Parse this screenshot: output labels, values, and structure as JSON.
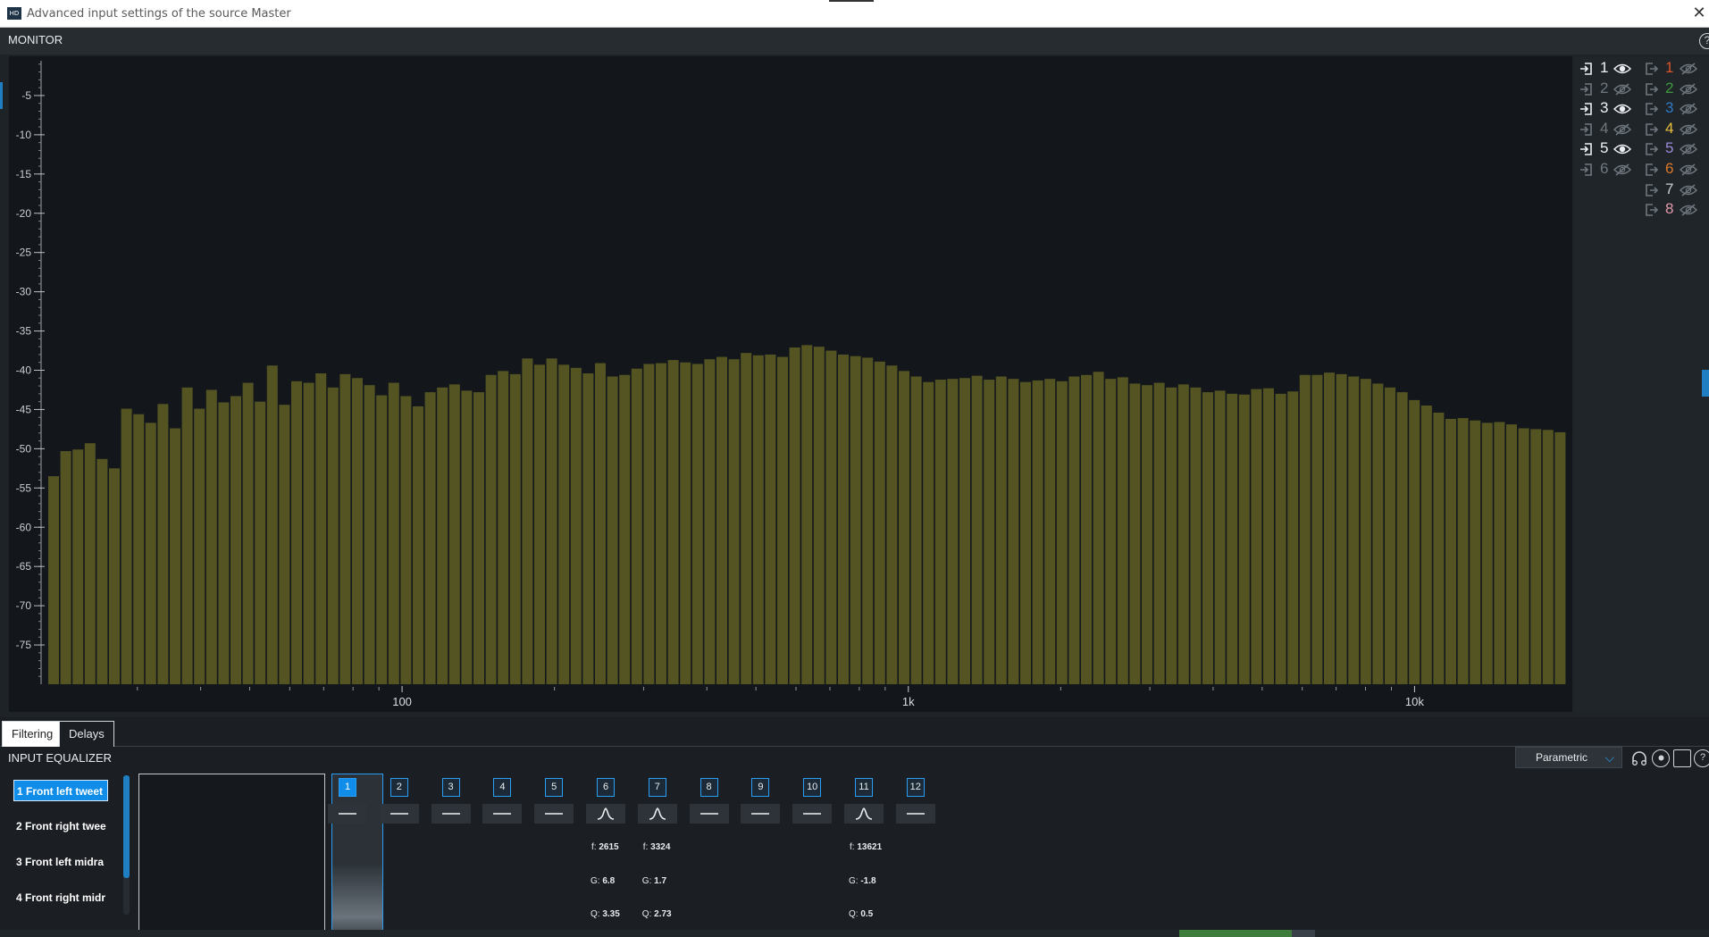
{
  "window": {
    "title": "Advanced input settings of the source Master",
    "app_icon_text": "HD",
    "close_glyph": "✕"
  },
  "monitor": {
    "title": "MONITOR",
    "help": "?"
  },
  "chart_data": {
    "type": "bar",
    "x_scale": "log",
    "y_ticks": [
      -5,
      -10,
      -15,
      -20,
      -25,
      -30,
      -35,
      -40,
      -45,
      -50,
      -55,
      -60,
      -65,
      -70,
      -75
    ],
    "ylim": [
      -80,
      0
    ],
    "x_tick_labels": [
      "100",
      "1k",
      "10k"
    ],
    "bar_color": "#545423",
    "series": [
      {
        "values": [
          -53.5,
          -50.3,
          -50.1,
          -49.3,
          -51.3,
          -52.5,
          -44.9,
          -45.6,
          -46.7,
          -44.3,
          -47.4,
          -42.2,
          -44.9,
          -42.5,
          -44.1,
          -43.3,
          -41.6,
          -44.0,
          -39.4,
          -44.4,
          -41.4,
          -41.6,
          -40.4,
          -42.2,
          -40.5,
          -41.0,
          -41.9,
          -43.2,
          -41.6,
          -43.3,
          -44.6,
          -42.8,
          -42.2,
          -41.8,
          -42.6,
          -42.8,
          -40.6,
          -40.1,
          -40.5,
          -38.5,
          -39.3,
          -38.5,
          -39.3,
          -39.7,
          -40.4,
          -39.1,
          -40.8,
          -40.6,
          -39.8,
          -39.2,
          -39.1,
          -38.7,
          -39.0,
          -39.2,
          -38.6,
          -38.3,
          -38.6,
          -37.8,
          -38.1,
          -38.0,
          -38.3,
          -37.1,
          -36.8,
          -37.0,
          -37.5,
          -38.0,
          -38.2,
          -38.4,
          -38.9,
          -39.4,
          -40.1,
          -40.8,
          -41.5,
          -41.2,
          -41.1,
          -41.0,
          -40.7,
          -41.2,
          -40.8,
          -41.1,
          -41.5,
          -41.3,
          -41.1,
          -41.4,
          -40.8,
          -40.6,
          -40.2,
          -41.1,
          -40.9,
          -41.7,
          -41.9,
          -41.6,
          -42.2,
          -41.8,
          -42.2,
          -42.8,
          -42.6,
          -43.0,
          -43.1,
          -42.4,
          -42.3,
          -43.0,
          -42.7,
          -40.6,
          -40.6,
          -40.3,
          -40.5,
          -40.8,
          -41.1,
          -41.7,
          -42.2,
          -42.8,
          -43.8,
          -44.5,
          -45.4,
          -46.2,
          -46.1,
          -46.4,
          -46.7,
          -46.6,
          -46.9,
          -47.4,
          -47.5,
          -47.6,
          -47.9
        ]
      }
    ]
  },
  "legend": {
    "inputs": [
      {
        "num": "1",
        "visible": true
      },
      {
        "num": "2",
        "visible": false
      },
      {
        "num": "3",
        "visible": true
      },
      {
        "num": "4",
        "visible": false
      },
      {
        "num": "5",
        "visible": true
      },
      {
        "num": "6",
        "visible": false
      }
    ],
    "outputs": [
      {
        "num": "1",
        "color": "#d9542b"
      },
      {
        "num": "2",
        "color": "#3f9a3f"
      },
      {
        "num": "3",
        "color": "#2f78c4"
      },
      {
        "num": "4",
        "color": "#e9c03a"
      },
      {
        "num": "5",
        "color": "#9b8ad8"
      },
      {
        "num": "6",
        "color": "#d8782a"
      },
      {
        "num": "7",
        "color": "#c9ced3"
      },
      {
        "num": "8",
        "color": "#e39aa8"
      }
    ]
  },
  "tabs": [
    {
      "label": "Filtering",
      "active": true
    },
    {
      "label": "Delays",
      "active": false
    }
  ],
  "equalizer": {
    "title": "INPUT EQUALIZER",
    "mode": "Parametric",
    "mode_chevron": "⌵",
    "help": "?",
    "channels": [
      {
        "label": "1  Front left tweet",
        "selected": true
      },
      {
        "label": "2  Front right twee",
        "selected": false
      },
      {
        "label": "3  Front left midra",
        "selected": false
      },
      {
        "label": "4  Front right midr",
        "selected": false
      }
    ],
    "bands": [
      {
        "num": "1",
        "shape": "flat"
      },
      {
        "num": "2",
        "shape": "flat"
      },
      {
        "num": "3",
        "shape": "flat"
      },
      {
        "num": "4",
        "shape": "flat"
      },
      {
        "num": "5",
        "shape": "flat"
      },
      {
        "num": "6",
        "shape": "peak",
        "f": "2615",
        "g": "6.8",
        "q": "3.35"
      },
      {
        "num": "7",
        "shape": "peak",
        "f": "3324",
        "g": "1.7",
        "q": "2.73"
      },
      {
        "num": "8",
        "shape": "flat"
      },
      {
        "num": "9",
        "shape": "flat"
      },
      {
        "num": "10",
        "shape": "flat"
      },
      {
        "num": "11",
        "shape": "peak",
        "f": "13621",
        "g": "-1.8",
        "q": "0.5"
      },
      {
        "num": "12",
        "shape": "flat"
      }
    ],
    "param_labels": {
      "f": "f:",
      "g": "G:",
      "q": "Q:"
    }
  }
}
